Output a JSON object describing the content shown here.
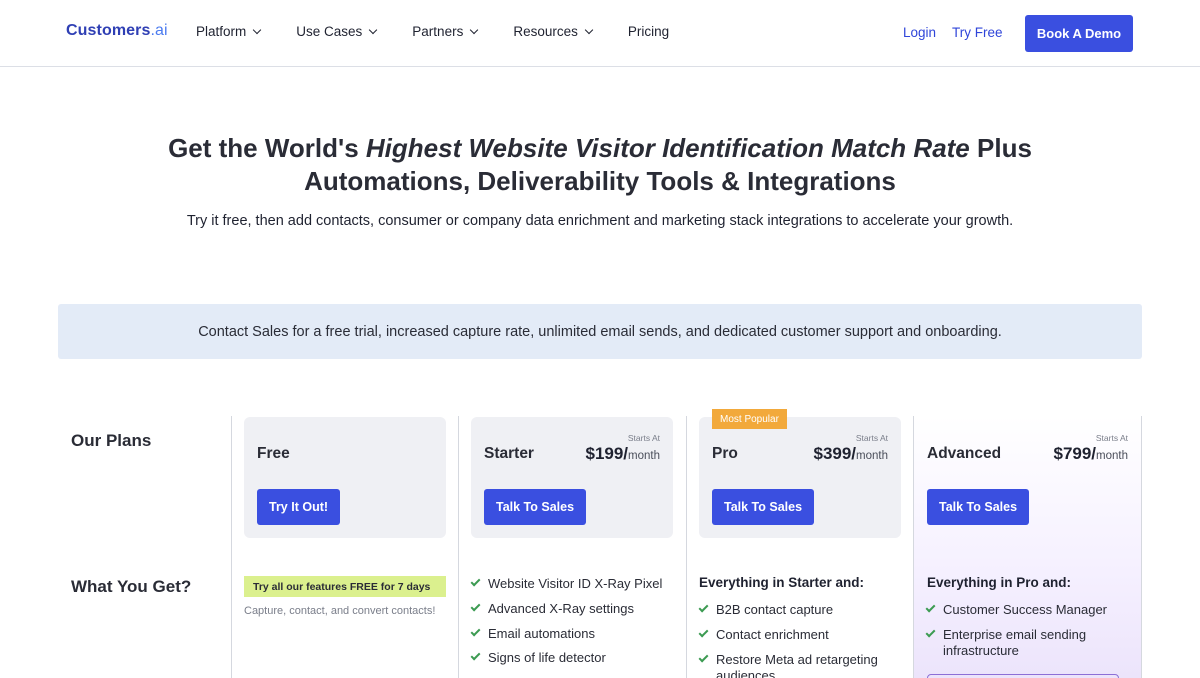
{
  "nav": {
    "logo_main": "Customers",
    "logo_suffix": ".ai",
    "menu": [
      {
        "label": "Platform",
        "dropdown": true
      },
      {
        "label": "Use Cases",
        "dropdown": true
      },
      {
        "label": "Partners",
        "dropdown": true
      },
      {
        "label": "Resources",
        "dropdown": true
      },
      {
        "label": "Pricing",
        "dropdown": false
      }
    ],
    "login": "Login",
    "try_free": "Try Free",
    "book_demo": "Book A Demo"
  },
  "hero": {
    "title_a": "Get the World's ",
    "title_em": "Highest Website Visitor Identification Match Rate",
    "title_b": " Plus",
    "title_line2": "Automations, Deliverability Tools & Integrations",
    "subtitle": "Try it free, then add contacts, consumer or company data enrichment and marketing stack integrations to accelerate your growth."
  },
  "notice": "Contact Sales for a free trial, increased capture rate, unlimited email sends, and dedicated customer support and onboarding.",
  "labels": {
    "our_plans": "Our Plans",
    "what_you_get": "What You Get?"
  },
  "plans": {
    "free": {
      "name": "Free",
      "cta": "Try It Out!",
      "trial_badge": "Try all our features FREE for 7 days",
      "trial_sub": "Capture, contact, and convert contacts!"
    },
    "starter": {
      "name": "Starter",
      "starts": "Starts At",
      "price": "$199/",
      "per": "month",
      "cta": "Talk To Sales",
      "features": [
        "Website Visitor ID X-Ray Pixel",
        "Advanced X-Ray settings",
        "Email automations",
        "Signs of life detector"
      ]
    },
    "pro": {
      "name": "Pro",
      "badge": "Most Popular",
      "starts": "Starts At",
      "price": "$399/",
      "per": "month",
      "cta": "Talk To Sales",
      "head": "Everything in Starter and:",
      "features": [
        "B2B contact capture",
        "Contact enrichment",
        "Restore Meta ad retargeting audiences"
      ]
    },
    "advanced": {
      "name": "Advanced",
      "starts": "Starts At",
      "price": "$799/",
      "per": "month",
      "cta": "Talk To Sales",
      "head": "Everything in Pro and:",
      "features": [
        "Customer Success Manager",
        "Enterprise email sending infrastructure"
      ]
    }
  },
  "colors": {
    "primary": "#3a4fe0",
    "notice_bg": "#e3ebf7",
    "popular": "#f2a93b",
    "trial": "#dbf08e",
    "check": "#3c9b52"
  }
}
